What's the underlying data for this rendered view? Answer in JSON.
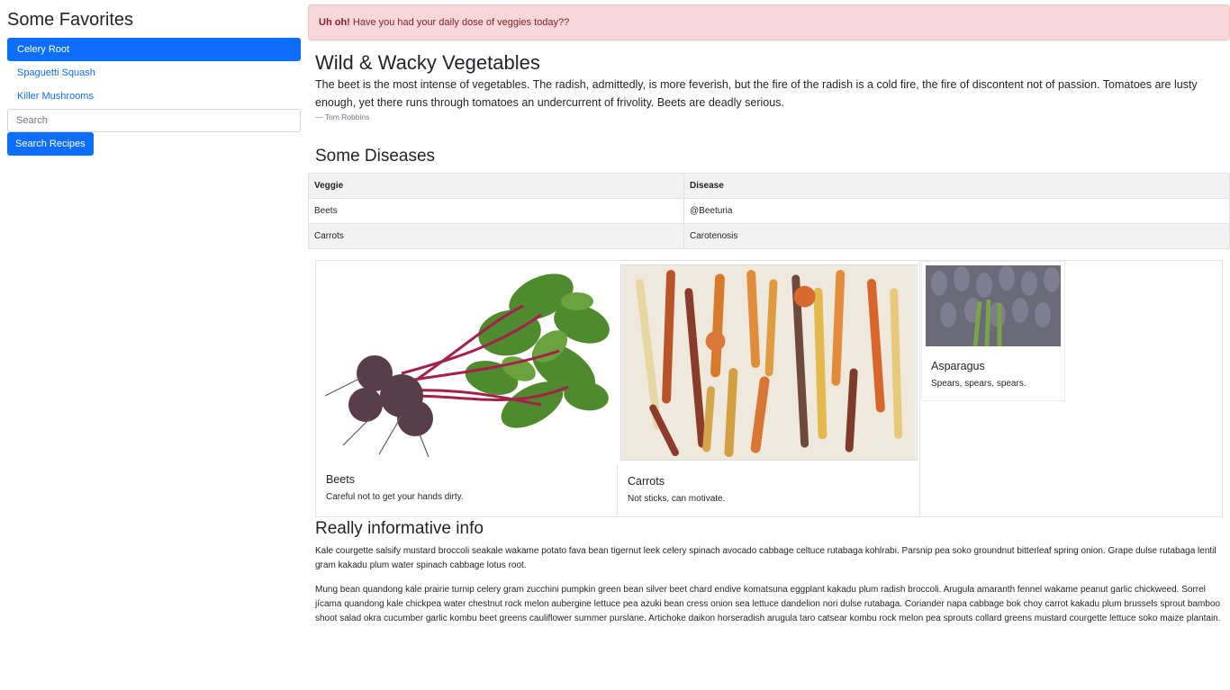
{
  "sidebar": {
    "title": "Some Favorites",
    "items": [
      {
        "label": "Celery Root",
        "active": true
      },
      {
        "label": "Spaguetti Squash",
        "active": false
      },
      {
        "label": "Killer Mushrooms",
        "active": false
      }
    ],
    "search_placeholder": "Search",
    "search_button": "Search Recipes"
  },
  "alert": {
    "strong": "Uh oh!",
    "text": " Have you had your daily dose of veggies today??"
  },
  "intro": {
    "title": "Wild & Wacky Vegetables",
    "quote": "The beet is the most intense of vegetables. The radish, admittedly, is more feverish, but the fire of the radish is a cold fire, the fire of discontent not of passion. Tomatoes are lusty enough, yet there runs through tomatoes an undercurrent of frivolity. Beets are deadly serious.",
    "author": "Tom Robbins"
  },
  "diseases": {
    "title": "Some Diseases",
    "headers": [
      "Veggie",
      "Disease"
    ],
    "rows": [
      [
        "Beets",
        "@Beeturia"
      ],
      [
        "Carrots",
        "Carotenosis"
      ]
    ]
  },
  "cards": [
    {
      "title": "Beets",
      "text": "Careful not to get your hands dirty.",
      "image": "beets-photo"
    },
    {
      "title": "Carrots",
      "text": "Not sticks, can motivate.",
      "image": "carrots-photo"
    },
    {
      "title": "Asparagus",
      "text": "Spears, spears, spears.",
      "image": "asparagus-photo"
    }
  ],
  "info": {
    "title": "Really informative info",
    "paragraphs": [
      "Kale courgette salsify mustard broccoli seakale wakame potato fava bean tigernut leek celery spinach avocado cabbage celtuce rutabaga kohlrabi. Parsnip pea soko groundnut bitterleaf spring onion. Grape dulse rutabaga lentil gram kakadu plum water spinach cabbage lotus root.",
      "Mung bean quandong kale prairie turnip celery gram zucchini pumpkin green bean silver beet chard endive komatsuna eggplant kakadu plum radish broccoli. Arugula amaranth fennel wakame peanut garlic chickweed. Sorrel jícama quandong kale chickpea water chestnut rock melon aubergine lettuce pea azuki bean cress onion sea lettuce dandelion nori dulse rutabaga. Coriander napa cabbage bok choy carrot kakadu plum brussels sprout bamboo shoot salad okra cucumber garlic kombu beet greens cauliflower summer purslane. Artichoke daikon horseradish arugula taro catsear kombu rock melon pea sprouts collard greens mustard courgette lettuce soko maize plantain."
    ]
  }
}
